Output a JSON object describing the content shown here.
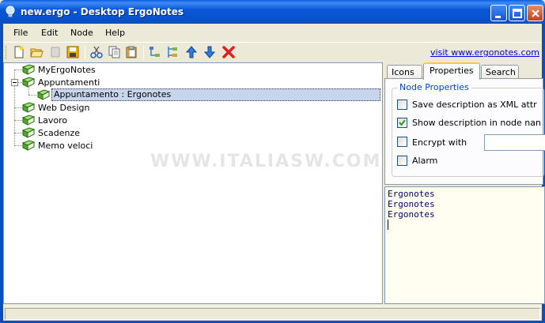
{
  "window": {
    "title": "new.ergo - Desktop ErgoNotes"
  },
  "menu": {
    "items": [
      "File",
      "Edit",
      "Node",
      "Help"
    ]
  },
  "toolbar": {
    "buttons": [
      "new-file-icon",
      "open-folder-icon",
      "blank-icon",
      "save-icon",
      "cut-icon",
      "copy-icon",
      "paste-icon",
      "add-child-node-icon",
      "add-sibling-node-icon",
      "move-up-icon",
      "move-down-icon",
      "delete-icon"
    ],
    "link": "visit www.ergonotes.com"
  },
  "tree": {
    "nodes": [
      {
        "label": "MyErgoNotes",
        "level": 0
      },
      {
        "label": "Appuntamenti",
        "level": 0,
        "expanded": true
      },
      {
        "label": "Appuntamento : Ergonotes",
        "level": 1,
        "selected": true
      },
      {
        "label": "Web Design",
        "level": 0
      },
      {
        "label": "Lavoro",
        "level": 0
      },
      {
        "label": "Scadenze",
        "level": 0
      },
      {
        "label": "Memo veloci",
        "level": 0
      }
    ]
  },
  "tabs": {
    "items": [
      "Icons",
      "Properties",
      "Search"
    ],
    "active": "Properties"
  },
  "properties": {
    "group_title": "Node Properties",
    "save_description_xml": {
      "label": "Save description as XML attr",
      "checked": false
    },
    "show_description": {
      "label": "Show description in node nan",
      "checked": true
    },
    "encrypt": {
      "label": "Encrypt with",
      "checked": false,
      "value": ""
    },
    "alarm": {
      "label": "Alarm",
      "checked": false
    }
  },
  "description": {
    "lines": [
      "Ergonotes",
      "Ergonotes",
      "Ergonotes"
    ]
  },
  "watermark": "WWW.ITALIASW.COM",
  "colors": {
    "titlebar": "#0A58D8",
    "selection": "#C7D6EC",
    "tab_accent": "#FFC83C",
    "group_title": "#0046D5"
  }
}
